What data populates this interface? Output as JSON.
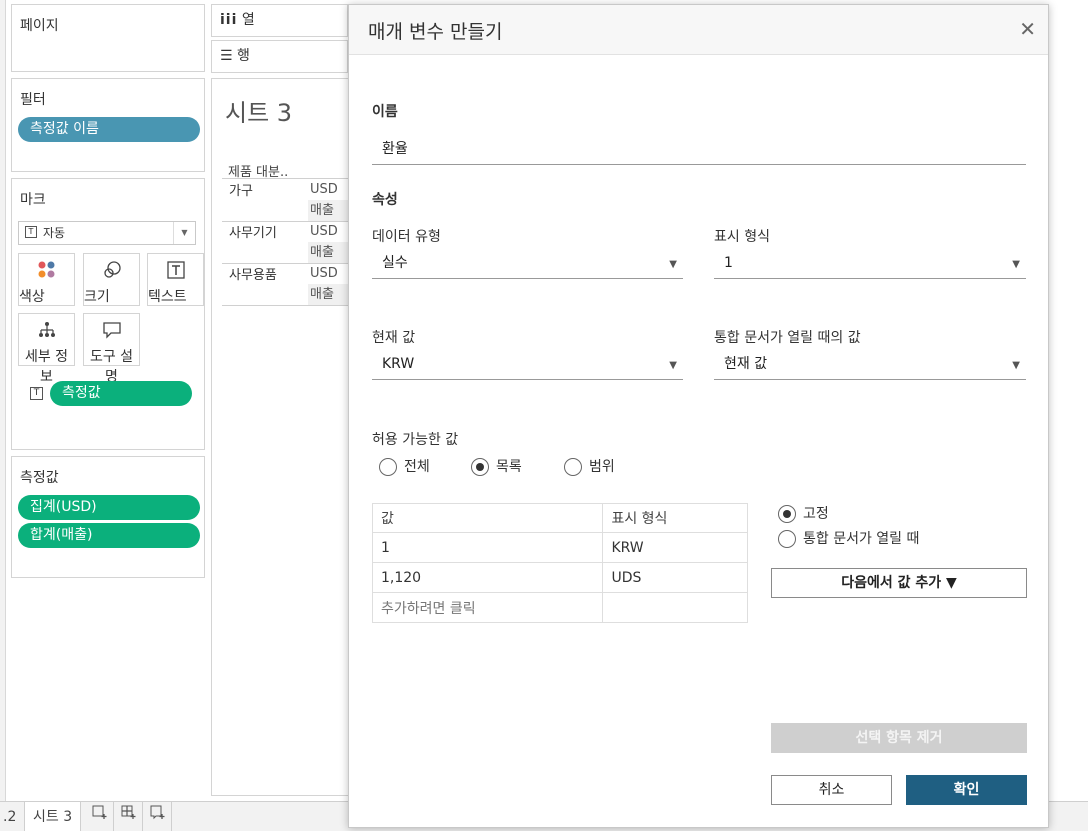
{
  "shelves": {
    "pages": {
      "title": "페이지"
    },
    "filters": {
      "title": "필터",
      "pill": "측정값 이름"
    },
    "marks": {
      "title": "마크",
      "type_select": "자동",
      "buttons": [
        "색상",
        "크기",
        "텍스트",
        "세부 정보",
        "도구 설명"
      ],
      "text_pill": "측정값"
    },
    "measure_values": {
      "title": "측정값",
      "pills": [
        "집계(USD)",
        "합계(매출)"
      ]
    }
  },
  "columns_shelf": {
    "label": "열"
  },
  "rows_shelf": {
    "label": "행"
  },
  "sheet": {
    "title": "시트 3",
    "header": "제품 대분..",
    "rows": [
      {
        "category": "가구",
        "m1": "USD",
        "m2": "매출"
      },
      {
        "category": "사무기기",
        "m1": "USD",
        "m2": "매출"
      },
      {
        "category": "사무용품",
        "m1": "USD",
        "m2": "매출"
      }
    ]
  },
  "tabs": {
    "prev_partial": ".2",
    "active": "시트 3"
  },
  "dialog": {
    "title": "매개 변수 만들기",
    "name_label": "이름",
    "name_value": "환율",
    "properties_label": "속성",
    "data_type_label": "데이터 유형",
    "data_type_value": "실수",
    "display_format_label": "표시 형식",
    "display_format_value": "1",
    "current_value_label": "현재 값",
    "current_value": "KRW",
    "open_value_label": "통합 문서가 열릴 때의 값",
    "open_value": "현재 값",
    "allowable_label": "허용 가능한 값",
    "allowable_options": [
      "전체",
      "목록",
      "범위"
    ],
    "allowable_selected": "목록",
    "table": {
      "headers": [
        "값",
        "표시 형식"
      ],
      "rows": [
        [
          "1",
          "KRW"
        ],
        [
          "1,120",
          "UDS"
        ]
      ],
      "add_placeholder": "추가하려면 클릭"
    },
    "fixed_label": "고정",
    "on_open_label": "통합 문서가 열릴 때",
    "add_values_button": "다음에서 값 추가 ▼",
    "remove_button": "선택 항목 제거",
    "cancel_button": "취소",
    "ok_button": "확인"
  }
}
